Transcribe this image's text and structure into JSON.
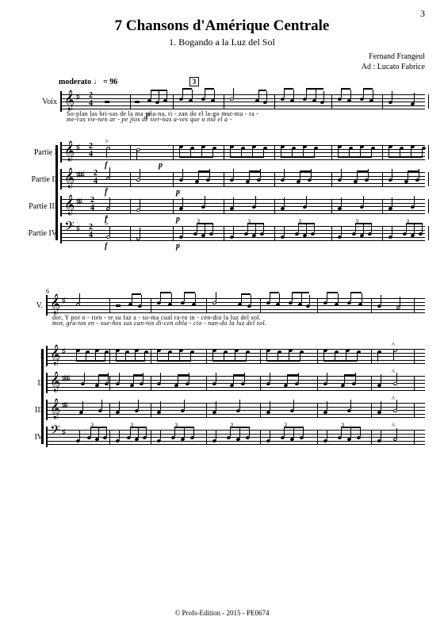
{
  "page_number": "3",
  "title": "7 Chansons d'Amérique Centrale",
  "subtitle": "1. Bogando a la Luz del Sol",
  "composer_line1": "Fernand Frangeul",
  "composer_line2": "Ad : Lucato Fabrice",
  "tempo": "moderato ♩ = 96",
  "rehearsal_mark": "3",
  "time_signature_top": "2",
  "time_signature_bottom": "4",
  "parts_sys1": {
    "voix": "Voix",
    "p1": "Partie I",
    "p2": "Partie II",
    "p3": "Partie III",
    "p4": "Partie IV"
  },
  "parts_sys2": {
    "voix": "V.",
    "p1": "I",
    "p2": "II",
    "p3": "III",
    "p4": "IV"
  },
  "dynamics": {
    "forte": "f",
    "piano": "p"
  },
  "tuplet_three": "3",
  "accent_mark": ">",
  "marcato_mark": "^",
  "lyrics": {
    "sys1_line1": "So-plan las   bri-sas   de   la       ma   -   ña-na,  ri - zan do el  la-go  mur-mu - ra  -",
    "sys1_line2": "me-ras vie-nen           ar - pe  jios  de tier-nas    a-ves que  u  nió el  a -",
    "sys2_line1": "dor,         Y   por   o - rien - te  su  faz   a - so-ma cual ra-ro in - cen-dio la luz del   sol.",
    "sys2_line2": "mor,   gra-tos  en - sue-ños sus can-tos    di-cen  obla - cio - nan-do la luz  del   sol."
  },
  "footer": "© Profs-Edition - 2015 - PE0674"
}
